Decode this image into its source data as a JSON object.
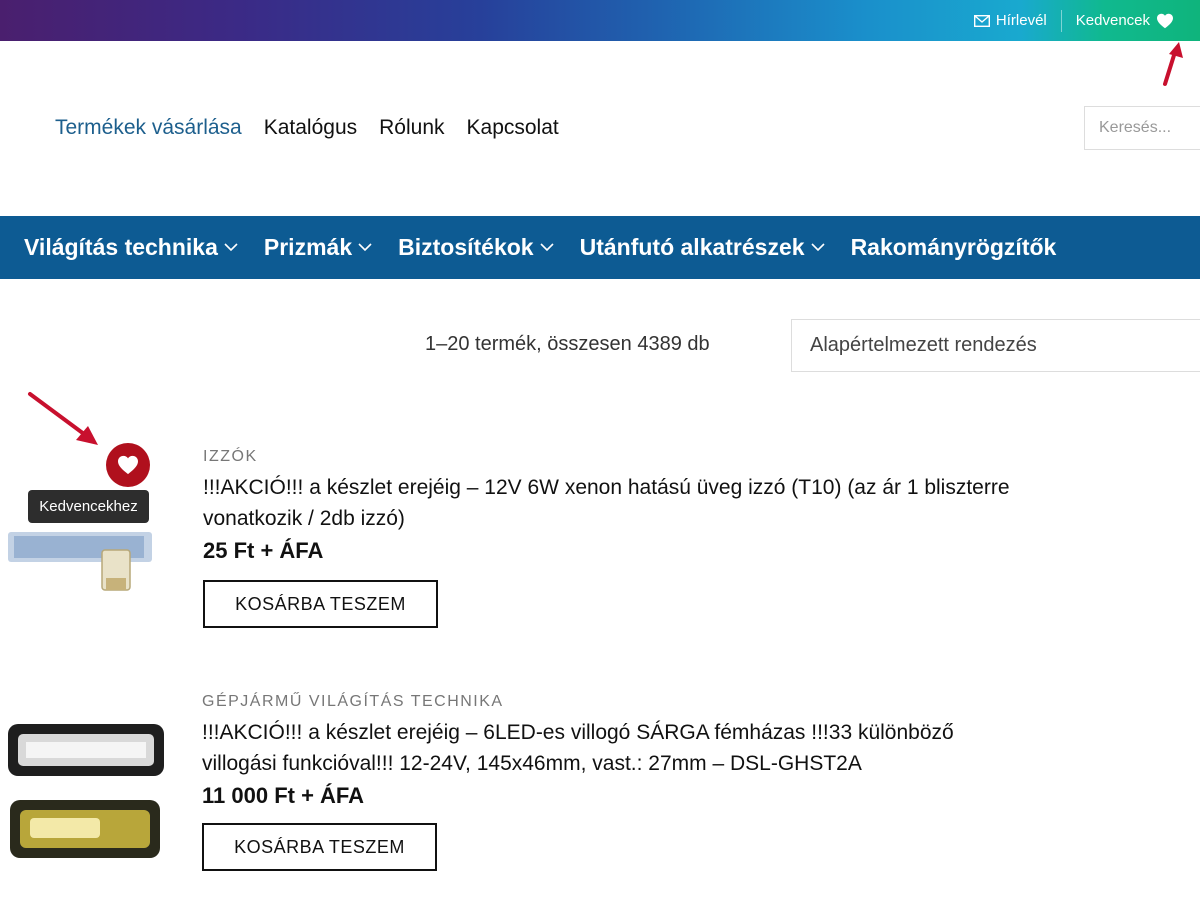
{
  "topbar": {
    "newsletter_label": "Hírlevél",
    "favorites_label": "Kedvencek"
  },
  "nav": {
    "items": [
      "Termékek vásárlása",
      "Katalógus",
      "Rólunk",
      "Kapcsolat"
    ]
  },
  "search": {
    "placeholder": "Keresés..."
  },
  "categories": [
    "Világítás technika",
    "Prizmák",
    "Biztosítékok",
    "Utánfutó alkatrészek",
    "Rakományrögzítők"
  ],
  "results": {
    "count_text": "1–20 termék, összesen 4389 db",
    "sort_selected": "Alapértelmezett rendezés"
  },
  "products": [
    {
      "category": "IZZÓK",
      "title_line1": "!!!AKCIÓ!!! a készlet erejéig – 12V 6W xenon hatású üveg izzó (T10) (az ár 1 bliszterre",
      "title_line2": "vonatkozik / 2db izzó)",
      "price": "25 Ft + ÁFA",
      "button": "KOSÁRBA TESZEM",
      "favorite_tooltip": "Kedvencekhez"
    },
    {
      "category": "GÉPJÁRMŰ VILÁGÍTÁS TECHNIKA",
      "title_line1": "!!!AKCIÓ!!! a készlet erejéig – 6LED-es villogó SÁRGA fémházas !!!33 különböző",
      "title_line2": "villogási funkcióval!!! 12-24V, 145x46mm, vast.: 27mm – DSL-GHST2A",
      "price": "11 000 Ft + ÁFA",
      "button": "KOSÁRBA TESZEM"
    }
  ],
  "colors": {
    "category_bar": "#0d5b93",
    "nav_active": "#1d5f8d",
    "favorite_red": "#b0101d",
    "annotation_arrow": "#c8102e"
  },
  "icons": {
    "newsletter": "mail-icon",
    "favorites": "heart-icon",
    "dropdown": "chevron-down-icon",
    "favorite_toggle": "heart-icon"
  }
}
